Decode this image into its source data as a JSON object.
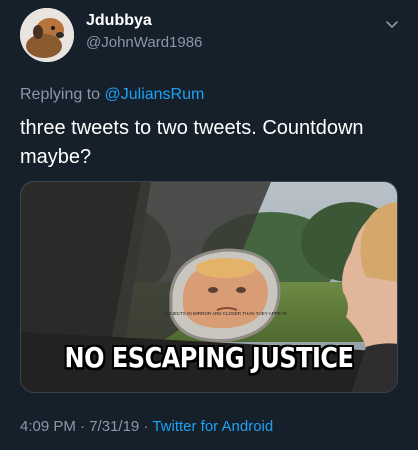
{
  "user": {
    "display_name": "Jdubbya",
    "handle": "@JohnWard1986"
  },
  "reply": {
    "prefix": "Replying to ",
    "mention": "@JuliansRum"
  },
  "tweet": {
    "text": "three tweets to two tweets.  Countdown maybe?"
  },
  "media": {
    "caption": "NO ESCAPING JUSTICE",
    "mirror_text": "OBJECTS IN MIRROR ARE CLOSER THAN THEY APPEAR"
  },
  "meta": {
    "time": "4:09 PM",
    "separator1": " · ",
    "date": "7/31/19",
    "separator2": " · ",
    "source": "Twitter for Android"
  },
  "colors": {
    "background": "#15202b",
    "secondary_text": "#8899a6",
    "link": "#1da1f2"
  },
  "icons": {
    "menu": "chevron-down-icon"
  }
}
